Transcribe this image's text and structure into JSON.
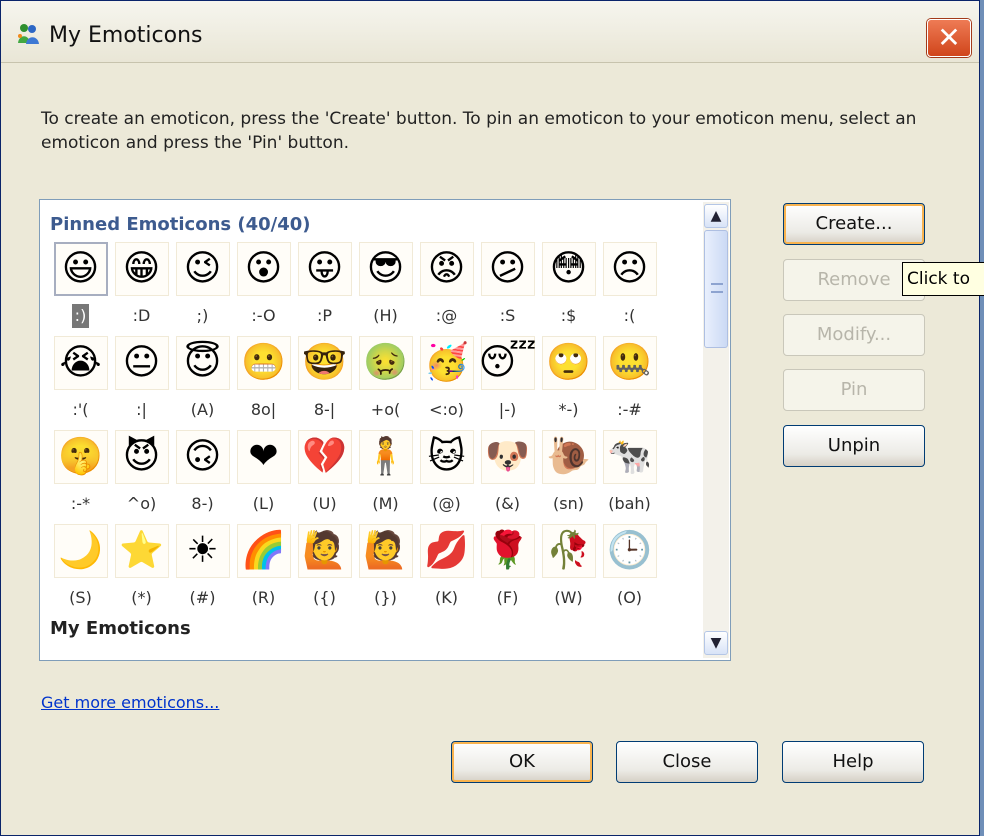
{
  "window": {
    "title": "My Emoticons",
    "instructions": "To create an emoticon, press the 'Create' button.  To pin an emoticon to your emoticon menu, select an emoticon and press the 'Pin' button."
  },
  "list": {
    "pinned_title": "Pinned Emoticons (40/40)",
    "my_title": "My Emoticons",
    "emoticons": [
      {
        "glyph": "😃",
        "code": ":)"
      },
      {
        "glyph": "😁",
        "code": ":D"
      },
      {
        "glyph": "😉",
        "code": ";)"
      },
      {
        "glyph": "😮",
        "code": ":-O"
      },
      {
        "glyph": "😛",
        "code": ":P"
      },
      {
        "glyph": "😎",
        "code": "(H)"
      },
      {
        "glyph": "😡",
        "code": ":@"
      },
      {
        "glyph": "😕",
        "code": ":S"
      },
      {
        "glyph": "😳",
        "code": ":$"
      },
      {
        "glyph": "☹",
        "code": ":("
      },
      {
        "glyph": "😭",
        "code": ":'("
      },
      {
        "glyph": "😐",
        "code": ":|"
      },
      {
        "glyph": "😇",
        "code": "(A)"
      },
      {
        "glyph": "😬",
        "code": "8o|"
      },
      {
        "glyph": "🤓",
        "code": "8-|"
      },
      {
        "glyph": "🤢",
        "code": "+o("
      },
      {
        "glyph": "🥳",
        "code": "<:o)"
      },
      {
        "glyph": "😴",
        "code": "|-)"
      },
      {
        "glyph": "🙄",
        "code": "*-)"
      },
      {
        "glyph": "🤐",
        "code": ":-#"
      },
      {
        "glyph": "🤫",
        "code": ":-*"
      },
      {
        "glyph": "😈",
        "code": "^o)"
      },
      {
        "glyph": "🙃",
        "code": "8-)"
      },
      {
        "glyph": "❤",
        "code": "(L)"
      },
      {
        "glyph": "💔",
        "code": "(U)"
      },
      {
        "glyph": "🧍",
        "code": "(M)"
      },
      {
        "glyph": "🐱",
        "code": "(@)"
      },
      {
        "glyph": "🐶",
        "code": "(&)"
      },
      {
        "glyph": "🐌",
        "code": "(sn)"
      },
      {
        "glyph": "🐄",
        "code": "(bah)"
      },
      {
        "glyph": "🌙",
        "code": "(S)"
      },
      {
        "glyph": "⭐",
        "code": "(*)"
      },
      {
        "glyph": "☀",
        "code": "(#)"
      },
      {
        "glyph": "🌈",
        "code": "(R)"
      },
      {
        "glyph": "🙋",
        "code": "({)"
      },
      {
        "glyph": "🙋",
        "code": "(})"
      },
      {
        "glyph": "💋",
        "code": "(K)"
      },
      {
        "glyph": "🌹",
        "code": "(F)"
      },
      {
        "glyph": "🥀",
        "code": "(W)"
      },
      {
        "glyph": "🕒",
        "code": "(O)"
      }
    ]
  },
  "buttons": {
    "create": "Create...",
    "remove": "Remove",
    "modify": "Modify...",
    "pin": "Pin",
    "unpin": "Unpin",
    "ok": "OK",
    "close": "Close",
    "help": "Help"
  },
  "tooltip": "Click to",
  "link": "Get more emoticons..."
}
